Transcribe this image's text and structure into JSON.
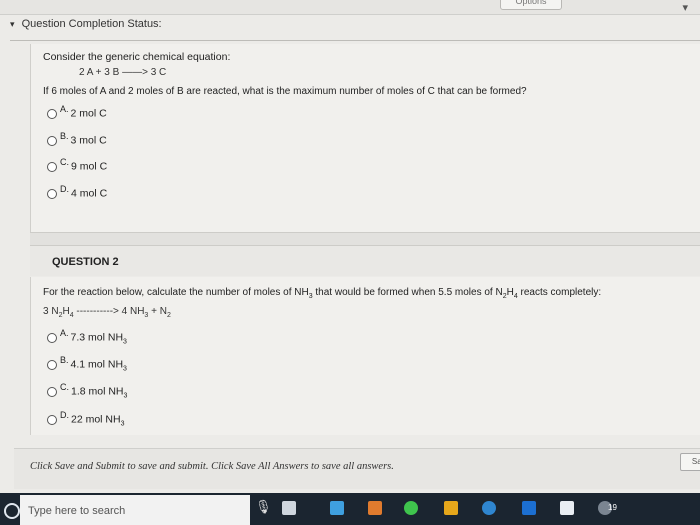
{
  "top": {
    "options_label": "Options",
    "chevron": "▾"
  },
  "status": {
    "icon": "chevron-down-icon",
    "label": "Question Completion Status:"
  },
  "question1": {
    "prompt": "Consider the generic chemical equation:",
    "equation": "2 A  +  3 B  ——>   3 C",
    "text": "If 6 moles of A and 2 moles of B are reacted, what is the maximum number of moles of C that can be formed?",
    "options": [
      {
        "letter": "A.",
        "text": "2 mol C"
      },
      {
        "letter": "B.",
        "text": "3 mol C"
      },
      {
        "letter": "C.",
        "text": "9 mol C"
      },
      {
        "letter": "D.",
        "text": "4 mol C"
      }
    ]
  },
  "question2": {
    "heading": "QUESTION 2",
    "text_part1": "For the reaction below, calculate the number of moles of NH",
    "sub3": "3",
    "text_part2": " that would be formed when 5.5 moles of N",
    "sub2": "2",
    "h": "H",
    "sub4": "4",
    "text_part3": " reacts completely:",
    "equation_lhs": "3 N",
    "equation_arrow": " -----------> 4 NH",
    "equation_rhs": " +  N",
    "options": [
      {
        "letter": "A.",
        "value": "7.3 mol NH"
      },
      {
        "letter": "B.",
        "value": "4.1 mol NH"
      },
      {
        "letter": "C.",
        "value": "1.8 mol NH"
      },
      {
        "letter": "D.",
        "value": "22 mol NH"
      }
    ]
  },
  "footer": {
    "submit_text": "Click Save and Submit to save and submit. Click Save All Answers to save all answers.",
    "save_label": "Save"
  },
  "taskbar": {
    "search_placeholder": "Type here to search",
    "badge": "19"
  }
}
